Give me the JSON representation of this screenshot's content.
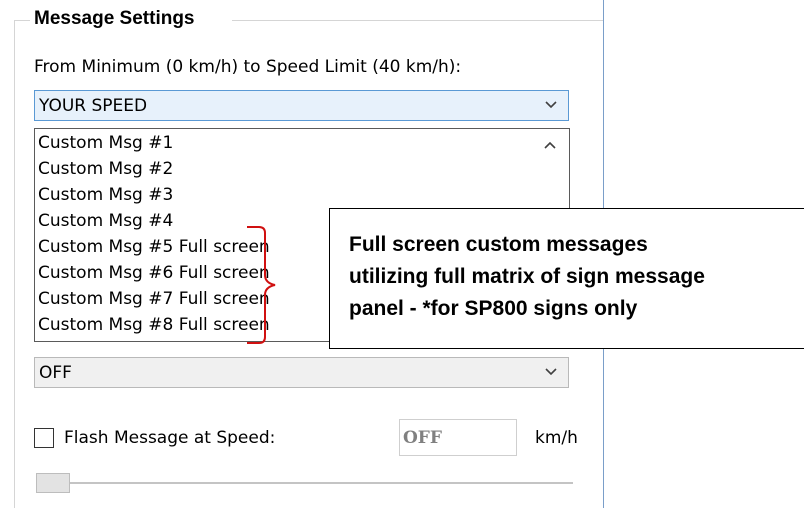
{
  "group": {
    "title": "Message Settings"
  },
  "range_caption": "From Minimum (0 km/h) to Speed Limit (40 km/h):",
  "message_combo": {
    "value": "YOUR SPEED",
    "expanded": true
  },
  "dropdown_items": [
    "Custom Msg #1",
    "Custom Msg #2",
    "Custom Msg #3",
    "Custom Msg #4",
    "Custom Msg #5 Full screen",
    "Custom Msg #6 Full screen",
    "Custom Msg #7 Full screen",
    "Custom Msg #8 Full screen"
  ],
  "callout": {
    "lines": [
      "Full screen custom messages",
      "utilizing full matrix of sign message",
      "panel - *for SP800 signs only"
    ]
  },
  "second_combo": {
    "value": "OFF"
  },
  "flash": {
    "label": "Flash Message at Speed:",
    "checked": false,
    "value": "OFF",
    "unit": "km/h"
  },
  "slider": {
    "position_fraction": 0
  },
  "colors": {
    "accent_border": "#5a99d4",
    "bracket": "#d01010",
    "frame": "#7a9ec9"
  }
}
